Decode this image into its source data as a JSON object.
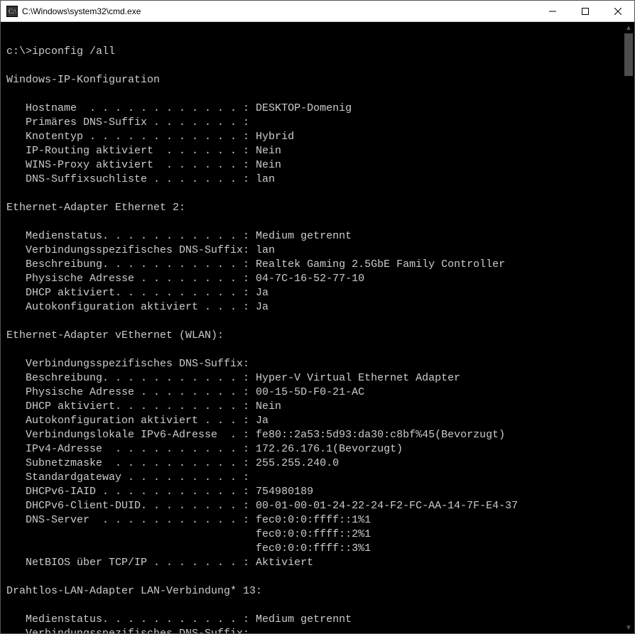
{
  "window": {
    "title": "C:\\Windows\\system32\\cmd.exe"
  },
  "prompt": "c:\\>",
  "command": "ipconfig /all",
  "sections": [
    {
      "heading": "Windows-IP-Konfiguration",
      "rows": [
        {
          "label": "Hostname  . . . . . . . . . . . . :",
          "value": " DESKTOP-Domenig"
        },
        {
          "label": "Primäres DNS-Suffix . . . . . . . :",
          "value": ""
        },
        {
          "label": "Knotentyp . . . . . . . . . . . . :",
          "value": " Hybrid"
        },
        {
          "label": "IP-Routing aktiviert  . . . . . . :",
          "value": " Nein"
        },
        {
          "label": "WINS-Proxy aktiviert  . . . . . . :",
          "value": " Nein"
        },
        {
          "label": "DNS-Suffixsuchliste . . . . . . . :",
          "value": " lan"
        }
      ]
    },
    {
      "heading": "Ethernet-Adapter Ethernet 2:",
      "rows": [
        {
          "label": "Medienstatus. . . . . . . . . . . :",
          "value": " Medium getrennt"
        },
        {
          "label": "Verbindungsspezifisches DNS-Suffix:",
          "value": " lan"
        },
        {
          "label": "Beschreibung. . . . . . . . . . . :",
          "value": " Realtek Gaming 2.5GbE Family Controller"
        },
        {
          "label": "Physische Adresse . . . . . . . . :",
          "value": " 04-7C-16-52-77-10"
        },
        {
          "label": "DHCP aktiviert. . . . . . . . . . :",
          "value": " Ja"
        },
        {
          "label": "Autokonfiguration aktiviert . . . :",
          "value": " Ja"
        }
      ]
    },
    {
      "heading": "Ethernet-Adapter vEthernet (WLAN):",
      "rows": [
        {
          "label": "Verbindungsspezifisches DNS-Suffix:",
          "value": ""
        },
        {
          "label": "Beschreibung. . . . . . . . . . . :",
          "value": " Hyper-V Virtual Ethernet Adapter"
        },
        {
          "label": "Physische Adresse . . . . . . . . :",
          "value": " 00-15-5D-F0-21-AC"
        },
        {
          "label": "DHCP aktiviert. . . . . . . . . . :",
          "value": " Nein"
        },
        {
          "label": "Autokonfiguration aktiviert . . . :",
          "value": " Ja"
        },
        {
          "label": "Verbindungslokale IPv6-Adresse  . :",
          "value": " fe80::2a53:5d93:da30:c8bf%45(Bevorzugt)"
        },
        {
          "label": "IPv4-Adresse  . . . . . . . . . . :",
          "value": " 172.26.176.1(Bevorzugt)"
        },
        {
          "label": "Subnetzmaske  . . . . . . . . . . :",
          "value": " 255.255.240.0"
        },
        {
          "label": "Standardgateway . . . . . . . . . :",
          "value": ""
        },
        {
          "label": "DHCPv6-IAID . . . . . . . . . . . :",
          "value": " 754980189"
        },
        {
          "label": "DHCPv6-Client-DUID. . . . . . . . :",
          "value": " 00-01-00-01-24-22-24-F2-FC-AA-14-7F-E4-37"
        },
        {
          "label": "DNS-Server  . . . . . . . . . . . :",
          "value": " fec0:0:0:ffff::1%1"
        },
        {
          "label": "                                   ",
          "value": " fec0:0:0:ffff::2%1"
        },
        {
          "label": "                                   ",
          "value": " fec0:0:0:ffff::3%1"
        },
        {
          "label": "NetBIOS über TCP/IP . . . . . . . :",
          "value": " Aktiviert"
        }
      ]
    },
    {
      "heading": "Drahtlos-LAN-Adapter LAN-Verbindung* 13:",
      "rows": [
        {
          "label": "Medienstatus. . . . . . . . . . . :",
          "value": " Medium getrennt"
        },
        {
          "label": "Verbindungsspezifisches DNS-Suffix:",
          "value": ""
        }
      ]
    }
  ]
}
